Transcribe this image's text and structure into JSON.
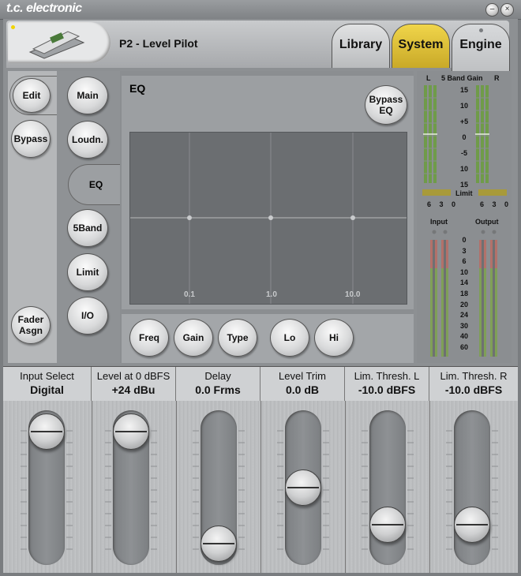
{
  "window": {
    "brand": "t.c. electronic",
    "minimize": "–",
    "close": "×"
  },
  "header": {
    "preset": "P2 - Level Pilot"
  },
  "tabs": [
    {
      "label": "Library"
    },
    {
      "label": "System"
    },
    {
      "label": "Engine"
    }
  ],
  "left_buttons": {
    "edit": "Edit",
    "bypass": "Bypass",
    "fader_assign": "Fader\nAsgn"
  },
  "nav": [
    {
      "label": "Main"
    },
    {
      "label": "Loudn."
    },
    {
      "label": "EQ"
    },
    {
      "label": "5Band"
    },
    {
      "label": "Limit"
    },
    {
      "label": "I/O"
    }
  ],
  "eq": {
    "title": "EQ",
    "bypass": "Bypass\nEQ",
    "freq_labels": [
      "0.1",
      "1.0",
      "10.0"
    ],
    "buttons": [
      {
        "label": "Freq"
      },
      {
        "label": "Gain"
      },
      {
        "label": "Type"
      },
      {
        "label": "Lo"
      },
      {
        "label": "Hi"
      }
    ]
  },
  "meters": {
    "gain_header": {
      "l": "L",
      "title": "5 Band Gain",
      "r": "R"
    },
    "gain_scale": [
      "15",
      "10",
      "+5",
      "0",
      "-5",
      "10",
      "15"
    ],
    "limit_label": "Limit",
    "limit_scale": [
      "6",
      "3",
      "0"
    ],
    "input_label": "Input",
    "output_label": "Output",
    "level_scale": [
      "0",
      "3",
      "6",
      "10",
      "14",
      "18",
      "20",
      "24",
      "30",
      "40",
      "60"
    ]
  },
  "faders": [
    {
      "name": "Input Select",
      "value": "Digital",
      "level": 0.0
    },
    {
      "name": "Level at 0 dBFS",
      "value": "+24 dBu",
      "level": 0.0
    },
    {
      "name": "Delay",
      "value": "0.0 Frms",
      "level": 1.0
    },
    {
      "name": "Level Trim",
      "value": "0.0 dB",
      "level": 0.5
    },
    {
      "name": "Lim. Thresh. L",
      "value": "-10.0 dBFS",
      "level": 0.83
    },
    {
      "name": "Lim. Thresh. R",
      "value": "-10.0 dBFS",
      "level": 0.83
    }
  ],
  "colors": {
    "system_tab": "#e0c437",
    "engine_tab": "#cfd1d3",
    "library_tab": "#c9cbcd",
    "meter_green": "#7fae52",
    "meter_red": "#b9756e"
  }
}
